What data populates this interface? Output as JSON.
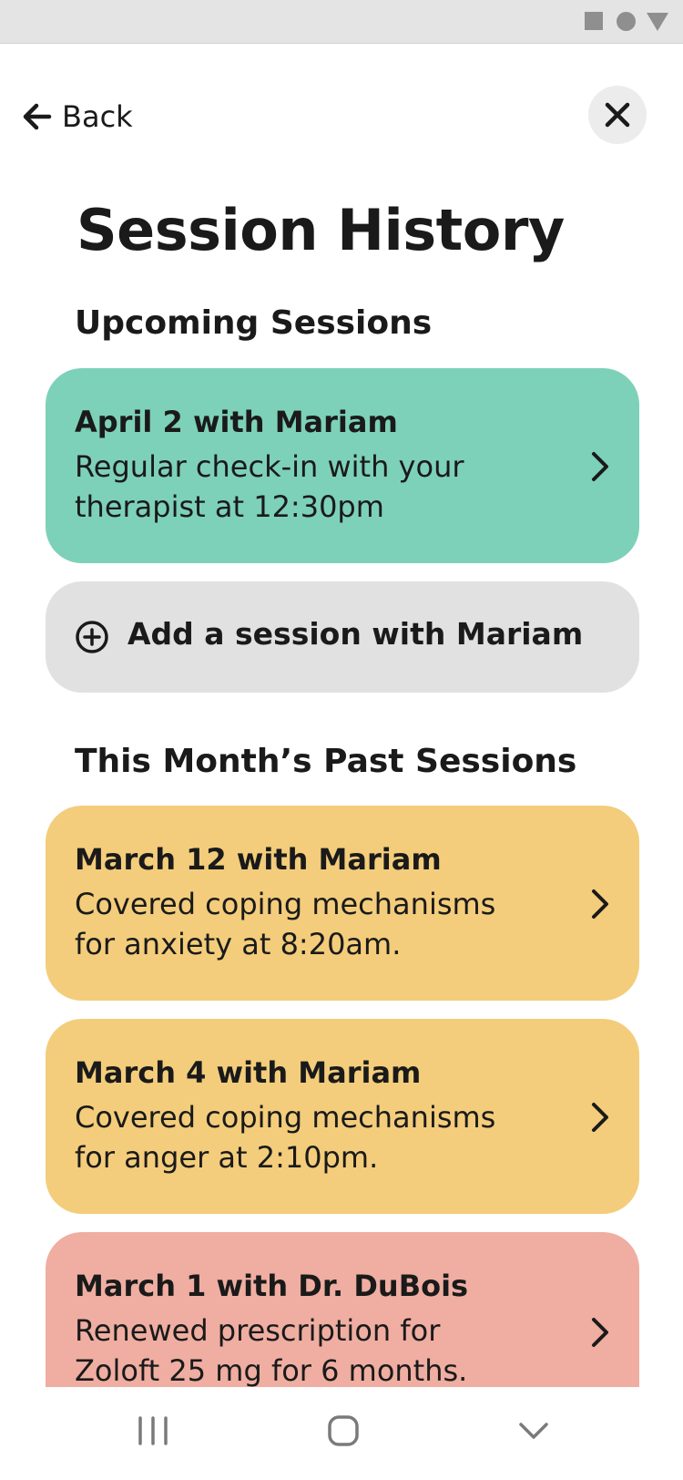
{
  "header": {
    "back_label": "Back"
  },
  "page_title": "Session History",
  "upcoming": {
    "heading": "Upcoming Sessions",
    "sessions": [
      {
        "title": "April 2 with Mariam",
        "description": "Regular check-in with your therapist at 12:30pm",
        "color": "#7dd1b8"
      }
    ],
    "add_label": "Add a session with Mariam"
  },
  "past": {
    "heading": "This Month’s Past Sessions",
    "sessions": [
      {
        "title": "March 12 with Mariam",
        "description": "Covered coping mechanisms for anxiety at 8:20am.",
        "color": "#f3cd7b"
      },
      {
        "title": "March 4 with Mariam",
        "description": "Covered coping mechanisms for anger at 2:10pm.",
        "color": "#f3cd7b"
      },
      {
        "title": "March 1 with Dr. DuBois",
        "description": "Renewed prescription for Zoloft 25 mg for 6 months.",
        "color": "#efaea1"
      }
    ]
  },
  "icons": {
    "back": "arrow-left-icon",
    "close": "close-icon",
    "add": "plus-circle-icon",
    "chevron": "chevron-right-icon",
    "nav_recents": "recents-icon",
    "nav_home": "home-icon",
    "nav_back": "chevron-down-icon"
  }
}
